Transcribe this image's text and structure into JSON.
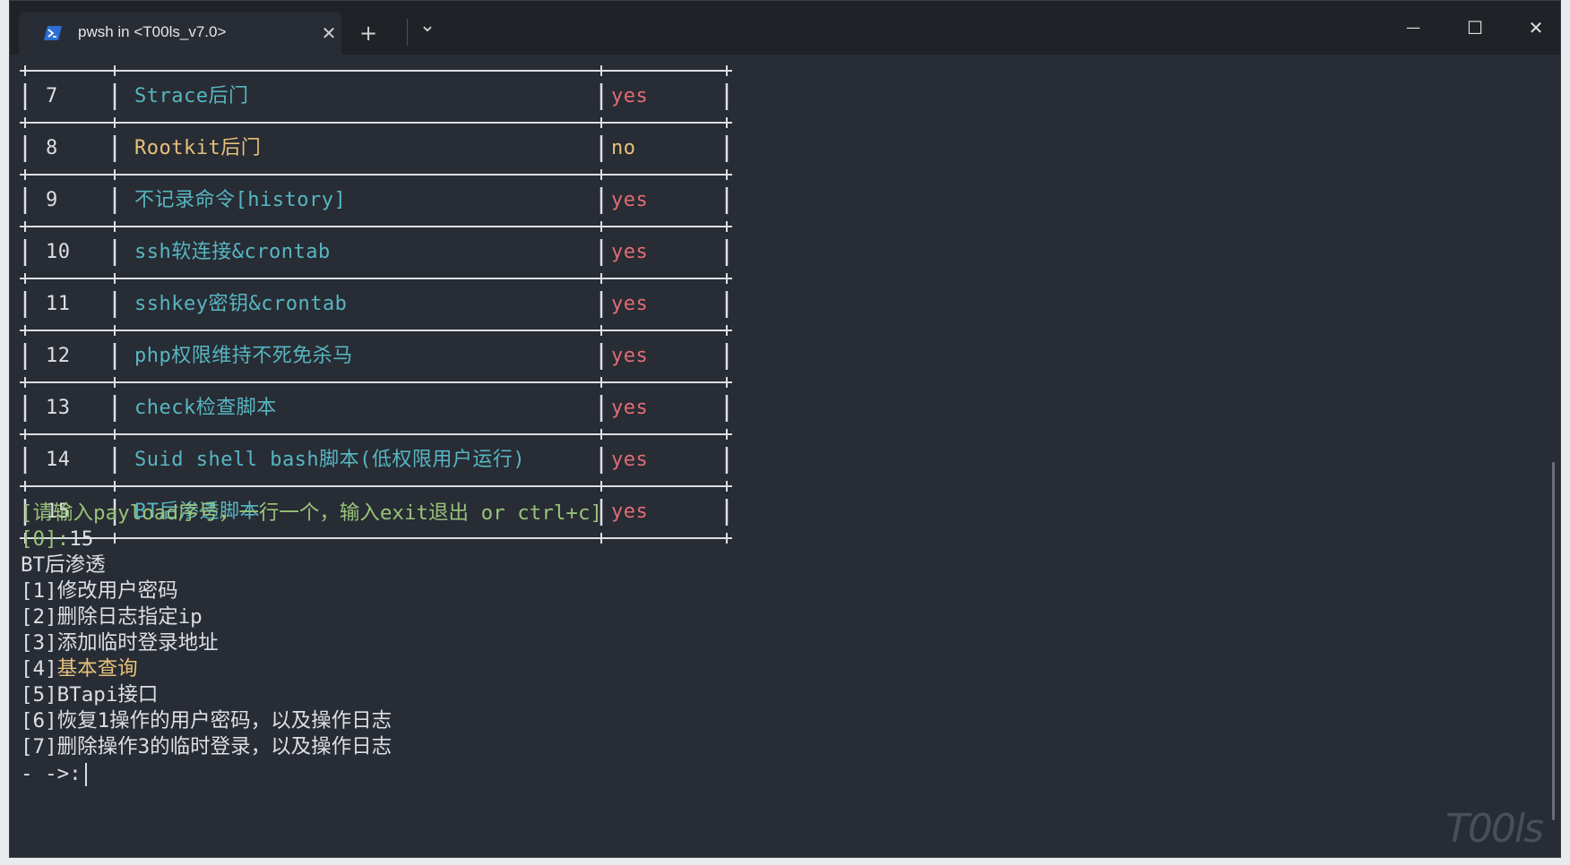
{
  "window": {
    "tab_title": "pwsh in <T00ls_v7.0>",
    "tab_icon": "powershell-icon",
    "close_tab_glyph": "✕",
    "new_tab_glyph": "+",
    "dropdown_glyph": "⌄",
    "minimize_glyph": "—",
    "maximize_glyph": "☐",
    "close_glyph": "✕"
  },
  "table": {
    "rows": [
      {
        "id": "7",
        "name": "Strace后门",
        "status": "yes",
        "name_color": "cyan"
      },
      {
        "id": "8",
        "name": "Rootkit后门",
        "status": "no",
        "name_color": "yellow"
      },
      {
        "id": "9",
        "name": "不记录命令[history]",
        "status": "yes",
        "name_color": "cyan"
      },
      {
        "id": "10",
        "name": "ssh软连接&crontab",
        "status": "yes",
        "name_color": "cyan"
      },
      {
        "id": "11",
        "name": "sshkey密钥&crontab",
        "status": "yes",
        "name_color": "cyan"
      },
      {
        "id": "12",
        "name": "php权限维持不死免杀马",
        "status": "yes",
        "name_color": "cyan"
      },
      {
        "id": "13",
        "name": "check检查脚本",
        "status": "yes",
        "name_color": "cyan"
      },
      {
        "id": "14",
        "name": "Suid shell bash脚本(低权限用户运行)",
        "status": "yes",
        "name_color": "cyan"
      },
      {
        "id": "15",
        "name": "BT后渗透脚本",
        "status": "yes",
        "name_color": "cyan"
      }
    ]
  },
  "output": {
    "prompt": "[请输入payload序号，一行一个，输入exit退出 or ctrl+c]",
    "input_prefix": "[0]:",
    "input_value": "15",
    "section_title": "BT后渗透",
    "menu": [
      {
        "key": "[1]",
        "label": "修改用户密码",
        "color": "default"
      },
      {
        "key": "[2]",
        "label": "删除日志指定ip",
        "color": "default"
      },
      {
        "key": "[3]",
        "label": "添加临时登录地址",
        "color": "default"
      },
      {
        "key": "[4]",
        "label": "基本查询",
        "color": "yellow"
      },
      {
        "key": "[5]",
        "label": "BTapi接口",
        "color": "default"
      },
      {
        "key": "[6]",
        "label": "恢复1操作的用户密码，以及操作日志",
        "color": "default"
      },
      {
        "key": "[7]",
        "label": "删除操作3的临时登录，以及操作日志",
        "color": "default"
      }
    ],
    "command_prompt": "- ->:"
  },
  "watermark": "T00ls",
  "colors": {
    "background": "#282c34",
    "cyan": "#56b6c2",
    "yellow": "#e5c07b",
    "red": "#e06c75",
    "green": "#98c379",
    "text": "#dcdfe4"
  }
}
